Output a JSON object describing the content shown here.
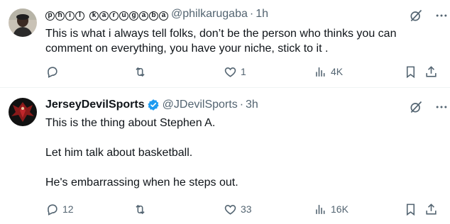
{
  "tweets": [
    {
      "display_name": "ⓟⓗⓘⓛ ⓚⓐⓡⓤⓖⓐⓑⓐ",
      "display_name_letters": [
        "p",
        "h",
        "i",
        "l",
        " ",
        "k",
        "a",
        "r",
        "u",
        "g",
        "a",
        "b",
        "a"
      ],
      "handle": "@philkarugaba",
      "dot": "·",
      "time": "1h",
      "verified": false,
      "text_lines": [
        "This is what i always tell folks, don’t be the person who thinks you can comment on everything, you have your niche, stick to it ."
      ],
      "reply_count": "",
      "repost_count": "",
      "like_count": "1",
      "view_count": "4K"
    },
    {
      "display_name": "JerseyDevilSports",
      "handle": "@JDevilSports",
      "dot": "·",
      "time": "3h",
      "verified": true,
      "text_lines": [
        "This is the thing about Stephen A.",
        "Let him talk about basketball.",
        "He's embarrassing when he steps out."
      ],
      "reply_count": "12",
      "repost_count": "",
      "like_count": "33",
      "view_count": "16K"
    }
  ],
  "colors": {
    "text": "#0f1419",
    "secondary": "#536471",
    "verified_blue": "#1d9bf0",
    "divider": "#eff3f4"
  },
  "icons": [
    "grok-icon",
    "more-icon",
    "reply-icon",
    "repost-icon",
    "like-icon",
    "views-icon",
    "bookmark-icon",
    "share-icon",
    "verified-badge-icon"
  ]
}
